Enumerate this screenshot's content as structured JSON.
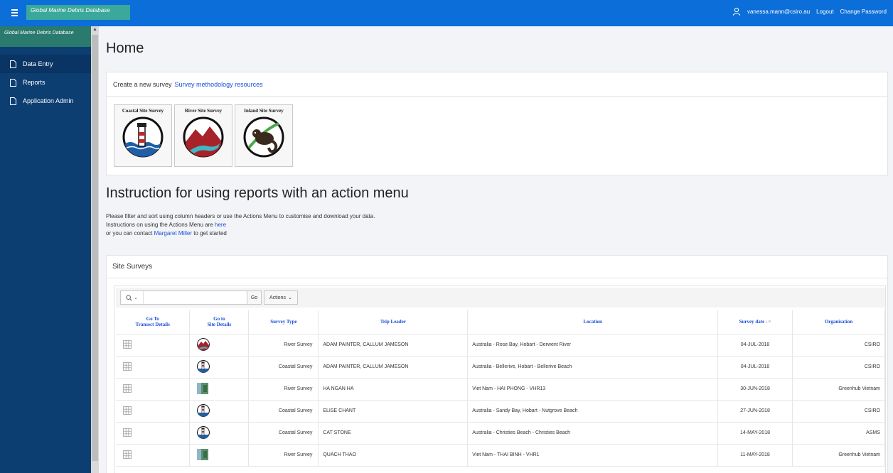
{
  "header": {
    "app_name": "Global Marine Debris Database",
    "user": "vanessa.mann@csiro.au",
    "logout": "Logout",
    "change_password": "Change Password"
  },
  "sidebar": {
    "title": "Global Marine Debris Database",
    "items": [
      {
        "label": "Data Entry",
        "icon": "document-icon"
      },
      {
        "label": "Reports",
        "icon": "document-icon"
      },
      {
        "label": "Application Admin",
        "icon": "document-icon"
      }
    ]
  },
  "main": {
    "page_title": "Home",
    "create": {
      "prefix": "Create a new survey",
      "link": "Survey methodology resources",
      "cards": [
        {
          "label": "Coastal Site Survey",
          "icon": "lighthouse-icon"
        },
        {
          "label": "River Site Survey",
          "icon": "river-icon"
        },
        {
          "label": "Inland Site Survey",
          "icon": "possum-icon"
        }
      ]
    },
    "instructions": {
      "title": "Instruction for using reports with an action menu",
      "line1": "Please filter and sort using column headers or use the Actions Menu to customise and download your data.",
      "line2_prefix": "Instructions on using the Actions Menu are",
      "line2_link": "here",
      "line3_prefix": "or you can contact",
      "line3_link": "Margaret Miller",
      "line3_suffix": "to get started"
    },
    "surveys": {
      "title": "Site Surveys",
      "search_placeholder": "",
      "go": "Go",
      "actions": "Actions",
      "columns": [
        "Go To\nTransect Details",
        "Go to\nSite Details",
        "Survey Type",
        "Trip Leader",
        "Location",
        "Survey date",
        "Organisation"
      ],
      "rows": [
        {
          "thumb": "river-icon",
          "type": "River Survey",
          "leader": "ADAM PAINTER, CALLUM JAMESON",
          "location": "Australia - Rose Bay, Hobart - Derwent River",
          "date": "04-JUL-2018",
          "org": "CSIRO"
        },
        {
          "thumb": "lighthouse-icon",
          "type": "Coastal Survey",
          "leader": "ADAM PAINTER, CALLUM JAMESON",
          "location": "Australia - Bellerive, Hobart - Bellerive Beach",
          "date": "04-JUL-2018",
          "org": "CSIRO"
        },
        {
          "thumb": "photo-icon",
          "type": "River Survey",
          "leader": "HA NGAN HA",
          "location": "Viet Nam - HAI PHONG - VHR13",
          "date": "30-JUN-2018",
          "org": "Greenhub Vietnam"
        },
        {
          "thumb": "lighthouse-icon",
          "type": "Coastal Survey",
          "leader": "ELISE CHANT",
          "location": "Australia - Sandy Bay, Hobart - Nutgrove Beach",
          "date": "27-JUN-2018",
          "org": "CSIRO"
        },
        {
          "thumb": "lighthouse-icon",
          "type": "Coastal Survey",
          "leader": "CAT STONE",
          "location": "Australia - Christies Beach - Christies Beach",
          "date": "14-MAY-2018",
          "org": "ASMS"
        },
        {
          "thumb": "photo-icon",
          "type": "River Survey",
          "leader": "QUACH THAO",
          "location": "Viet Nam - THAI BINH - VHR1",
          "date": "11-MAY-2018",
          "org": "Greenhub Vietnam"
        }
      ]
    }
  },
  "colors": {
    "topbar": "#0c6ed8",
    "sidebar": "#0c3e72",
    "badge": "#3aa89a",
    "link": "#1d4fd8"
  }
}
